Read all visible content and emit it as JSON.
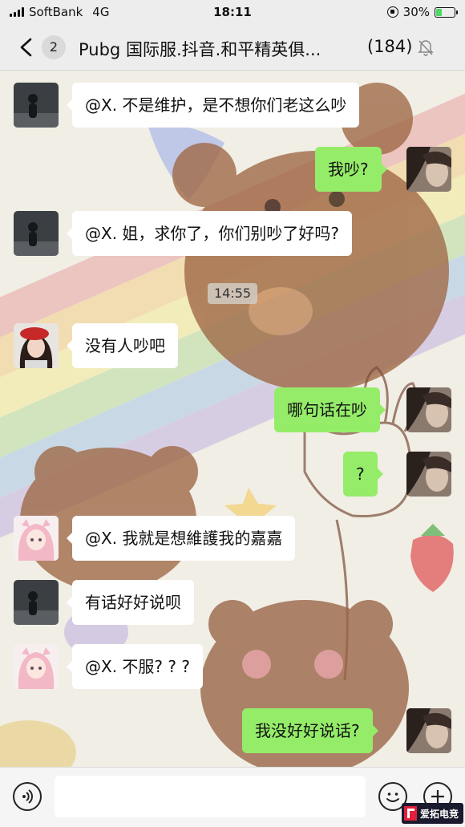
{
  "status_bar": {
    "carrier": "SoftBank",
    "network": "4G",
    "time": "18:11",
    "battery_percent": "30%",
    "battery_level": 0.3
  },
  "header": {
    "unread_count": "2",
    "title": "Pubg 国际服.抖音.和平精英俱...",
    "member_count": "(184)"
  },
  "messages": [
    {
      "direction": "in",
      "avatar": "avatar-dark-silhouette",
      "text": "@X. 不是维护，是不想你们老这么吵"
    },
    {
      "direction": "out",
      "avatar": "avatar-self",
      "text": "我吵?"
    },
    {
      "direction": "in",
      "avatar": "avatar-dark-silhouette",
      "text": "@X. 姐，求你了，你们别吵了好吗?"
    },
    {
      "direction": "in",
      "avatar": "avatar-red-beret-girl",
      "text": "没有人吵吧"
    },
    {
      "direction": "out",
      "avatar": "avatar-self",
      "text": "哪句话在吵"
    },
    {
      "direction": "out",
      "avatar": "avatar-self",
      "text": "?"
    },
    {
      "direction": "in",
      "avatar": "avatar-pink-anime-girl",
      "text": "@X. 我就是想維護我的嘉嘉"
    },
    {
      "direction": "in",
      "avatar": "avatar-dark-silhouette",
      "text": "有话好好说呗"
    },
    {
      "direction": "in",
      "avatar": "avatar-pink-anime-girl",
      "text": "@X. 不服? ? ?"
    },
    {
      "direction": "out",
      "avatar": "avatar-self",
      "text": "我没好好说话?"
    }
  ],
  "timestamp": "14:55",
  "watermark_text": "爱拓电竞",
  "colors": {
    "outgoing_bubble": "#95ec69",
    "incoming_bubble": "#ffffff",
    "bar_background": "#ededed"
  }
}
